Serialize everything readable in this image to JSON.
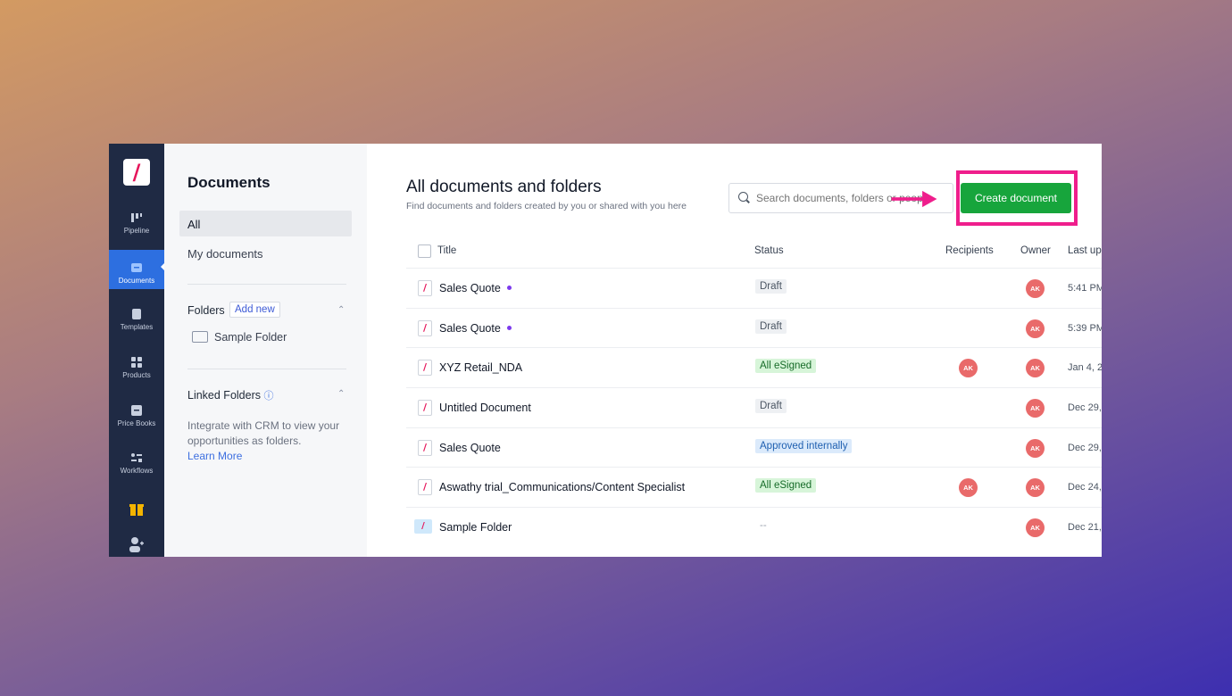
{
  "rail": {
    "logo": "/",
    "items": [
      {
        "label": "Pipeline"
      },
      {
        "label": "Documents"
      },
      {
        "label": "Templates"
      },
      {
        "label": "Products"
      },
      {
        "label": "Price Books"
      },
      {
        "label": "Workflows"
      }
    ]
  },
  "sidebar": {
    "title": "Documents",
    "nav": {
      "all": "All",
      "my": "My documents"
    },
    "folders_label": "Folders",
    "add_new": "Add new",
    "folder_items": [
      "Sample Folder"
    ],
    "linked_label": "Linked Folders",
    "linked_desc": "Integrate with CRM to view your opportunities as folders.",
    "learn_more": "Learn More"
  },
  "main": {
    "title": "All documents and folders",
    "subtitle": "Find documents and folders created by you or shared with you here",
    "search_placeholder": "Search documents, folders or people",
    "create_label": "Create document",
    "columns": {
      "title": "Title",
      "status": "Status",
      "recipients": "Recipients",
      "owner": "Owner",
      "last": "Last up"
    },
    "rows": [
      {
        "title": "Sales Quote",
        "unread": true,
        "status": "Draft",
        "status_type": "draft",
        "recipient": "",
        "owner": "AK",
        "last": "5:41 PM"
      },
      {
        "title": "Sales Quote",
        "unread": true,
        "status": "Draft",
        "status_type": "draft",
        "recipient": "",
        "owner": "AK",
        "last": "5:39 PM"
      },
      {
        "title": "XYZ Retail_NDA",
        "unread": false,
        "status": "All eSigned",
        "status_type": "esigned",
        "recipient": "AK",
        "owner": "AK",
        "last": "Jan 4, 2"
      },
      {
        "title": "Untitled Document",
        "unread": false,
        "status": "Draft",
        "status_type": "draft",
        "recipient": "",
        "owner": "AK",
        "last": "Dec 29,"
      },
      {
        "title": "Sales Quote",
        "unread": false,
        "status": "Approved internally",
        "status_type": "approved",
        "recipient": "",
        "owner": "AK",
        "last": "Dec 29,"
      },
      {
        "title": "Aswathy trial_Communications/Content Specialist",
        "unread": false,
        "status": "All eSigned",
        "status_type": "esigned",
        "recipient": "AK",
        "owner": "AK",
        "last": "Dec 24,"
      },
      {
        "title": "Sample Folder",
        "unread": false,
        "status": "--",
        "status_type": "none",
        "recipient": "",
        "owner": "AK",
        "last": "Dec 21,",
        "is_folder": true
      }
    ]
  },
  "colors": {
    "brand_pink": "#ef1e8c",
    "create_green": "#17a53c",
    "rail_bg": "#1f2a44",
    "active_blue": "#2d6fe0"
  }
}
